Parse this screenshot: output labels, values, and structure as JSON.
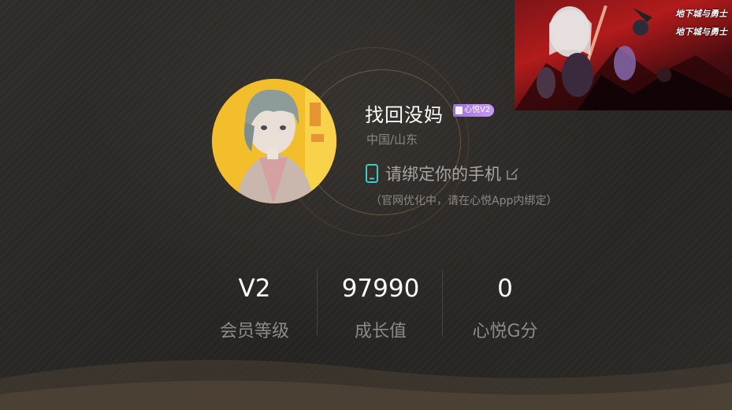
{
  "profile": {
    "username": "找回没妈",
    "vip_badge": "心悦V2",
    "location": "中国/山东",
    "phone_bind_label": "请绑定你的手机",
    "bind_note": "（官网优化中，请在心悦App内绑定）"
  },
  "stats": [
    {
      "value": "V2",
      "label": "会员等级"
    },
    {
      "value": "97990",
      "label": "成长值"
    },
    {
      "value": "0",
      "label": "心悦G分"
    }
  ],
  "banner": {
    "logo_line1": "地下城与勇士",
    "logo_line2": "地下城与勇士"
  },
  "colors": {
    "background": "#2a2826",
    "vip_badge": "#b184ec",
    "phone_icon": "#43c9c1",
    "muted_text": "#8e8b87"
  },
  "icons": [
    "phone-icon",
    "edit-icon",
    "vip-badge-icon"
  ]
}
